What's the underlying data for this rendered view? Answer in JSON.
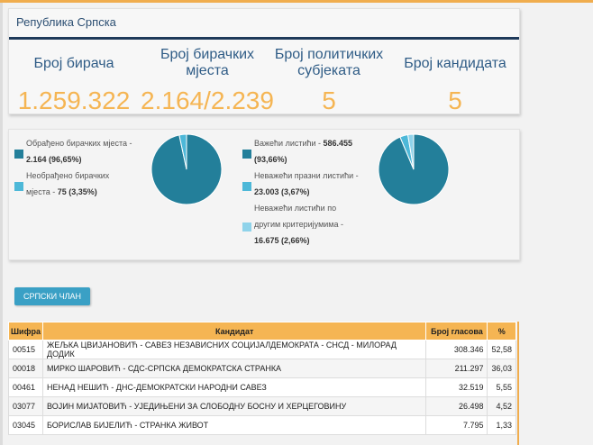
{
  "header": {
    "title": "Република Српска",
    "stats": [
      {
        "label_line1": "Број бирача",
        "label_line2": "",
        "value": "1.259.322"
      },
      {
        "label_line1": "Број бирачких",
        "label_line2": "мјеста",
        "value": "2.164/2.239"
      },
      {
        "label_line1": "Број политичких",
        "label_line2": "субјеката",
        "value": "5"
      },
      {
        "label_line1": "Број кандидата",
        "label_line2": "",
        "value": "5"
      }
    ]
  },
  "stations": {
    "processed_label": "Обрађено бирачких мјеста -",
    "processed_value": "2.164 (96,65%)",
    "unprocessed_label1": "Необрађено бирачких",
    "unprocessed_label2": "мјеста - ",
    "unprocessed_value": "75 (3,35%)",
    "chart": {
      "slices": [
        96.65,
        3.35
      ]
    }
  },
  "ballots": {
    "valid_label": "Важећи листићи - ",
    "valid_value1": "586.455",
    "valid_value2": "(93,66%)",
    "invalid_empty_label": "Неважећи празни листићи -",
    "invalid_empty_value": "23.003 (3,67%)",
    "invalid_other_label1": "Неважећи листићи по",
    "invalid_other_label2": "другим критеријумима -",
    "invalid_other_value": "16.675 (2,66%)",
    "chart": {
      "slices": [
        93.66,
        3.67,
        2.66
      ]
    }
  },
  "colors": {
    "dark_teal": "#237f9a",
    "light_blue": "#4db8d8",
    "pale_blue": "#8fd3ea",
    "orange": "#f5b553"
  },
  "button_label": "СРПСКИ ЧЛАН",
  "table": {
    "headers": [
      "Шифра",
      "Кандидат",
      "Број гласова",
      "%"
    ],
    "rows": [
      [
        "00515",
        "ЖЕЉКА ЦВИЈАНОВИЋ - САВЕЗ НЕЗАВИСНИХ СОЦИЈАЛДЕМОКРАТА - СНСД - МИЛОРАД ДОДИК",
        "308.346",
        "52,58"
      ],
      [
        "00018",
        "МИРКО ШАРОВИЋ - СДС-СРПСКА ДЕМОКРАТСКА СТРАНКА",
        "211.297",
        "36,03"
      ],
      [
        "00461",
        "НЕНАД НЕШИЋ - ДНС-ДЕМОКРАТСКИ НАРОДНИ САВЕЗ",
        "32.519",
        "5,55"
      ],
      [
        "03077",
        "ВОЈИН МИЈАТОВИЋ - УЈЕДИЊЕНИ ЗА СЛОБОДНУ БОСНУ И ХЕРЦЕГОВИНУ",
        "26.498",
        "4,52"
      ],
      [
        "03045",
        "БОРИСЛАВ БИЈЕЛИЋ - СТРАНКА ЖИВОТ",
        "7.795",
        "1,33"
      ]
    ]
  }
}
